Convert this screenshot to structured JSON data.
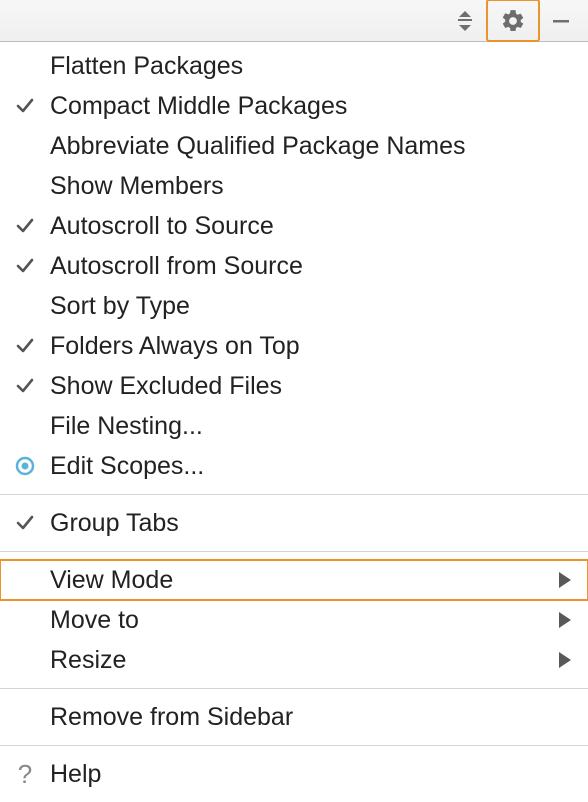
{
  "toolbar": {
    "collapse_icon": "collapse",
    "gear_icon": "gear",
    "minimize_icon": "minimize"
  },
  "menu": {
    "section1": [
      {
        "label": "Flatten Packages",
        "checked": false,
        "radio": false,
        "submenu": false
      },
      {
        "label": "Compact Middle Packages",
        "checked": true,
        "radio": false,
        "submenu": false
      },
      {
        "label": "Abbreviate Qualified Package Names",
        "checked": false,
        "radio": false,
        "submenu": false
      },
      {
        "label": "Show Members",
        "checked": false,
        "radio": false,
        "submenu": false
      },
      {
        "label": "Autoscroll to Source",
        "checked": true,
        "radio": false,
        "submenu": false
      },
      {
        "label": "Autoscroll from Source",
        "checked": true,
        "radio": false,
        "submenu": false
      },
      {
        "label": "Sort by Type",
        "checked": false,
        "radio": false,
        "submenu": false
      },
      {
        "label": "Folders Always on Top",
        "checked": true,
        "radio": false,
        "submenu": false
      },
      {
        "label": "Show Excluded Files",
        "checked": true,
        "radio": false,
        "submenu": false
      },
      {
        "label": "File Nesting...",
        "checked": false,
        "radio": false,
        "submenu": false
      },
      {
        "label": "Edit Scopes...",
        "checked": false,
        "radio": true,
        "submenu": false
      }
    ],
    "section2": [
      {
        "label": "Group Tabs",
        "checked": true,
        "radio": false,
        "submenu": false
      }
    ],
    "section3": [
      {
        "label": "View Mode",
        "checked": false,
        "radio": false,
        "submenu": true,
        "highlight": true
      },
      {
        "label": "Move to",
        "checked": false,
        "radio": false,
        "submenu": true
      },
      {
        "label": "Resize",
        "checked": false,
        "radio": false,
        "submenu": true
      }
    ],
    "section4": [
      {
        "label": "Remove from Sidebar",
        "checked": false,
        "radio": false,
        "submenu": false
      }
    ],
    "section5": [
      {
        "label": "Help",
        "checked": false,
        "radio": false,
        "submenu": false,
        "help": true
      }
    ]
  }
}
